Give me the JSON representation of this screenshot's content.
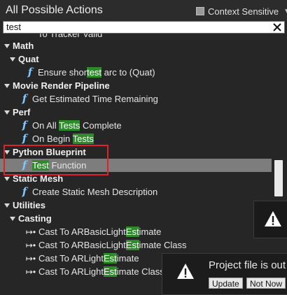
{
  "header": {
    "title": "All Possible Actions",
    "context_sensitive_label": "Context Sensitive",
    "context_sensitive_checked": false
  },
  "search": {
    "value": "test",
    "placeholder": ""
  },
  "list": {
    "partial_top": "To Tracker Valid",
    "rows": [
      {
        "kind": "cat",
        "label": "Math"
      },
      {
        "kind": "cat",
        "label": "Quat"
      },
      {
        "kind": "fn",
        "pre": "Ensure shor",
        "hl": "test",
        "post": " arc to (Quat)"
      },
      {
        "kind": "cat",
        "label": "Movie Render Pipeline"
      },
      {
        "kind": "fn",
        "pre": "Get Estimated Time Remaining",
        "hl": "",
        "post": ""
      },
      {
        "kind": "cat",
        "label": "Perf"
      },
      {
        "kind": "fn",
        "pre": "On All ",
        "hl": "Tests",
        "post": " Complete"
      },
      {
        "kind": "fn",
        "pre": "On Begin ",
        "hl": "Tests",
        "post": ""
      },
      {
        "kind": "cat",
        "label": "Python Blueprint"
      },
      {
        "kind": "fn",
        "pre": "",
        "hl": "Test",
        "post": " Function",
        "selected": true
      },
      {
        "kind": "cat",
        "label": "Static Mesh"
      },
      {
        "kind": "fn",
        "pre": "Create Static Mesh Description",
        "hl": "",
        "post": ""
      },
      {
        "kind": "cat",
        "label": "Utilities"
      },
      {
        "kind": "cat",
        "label": "Casting"
      },
      {
        "kind": "cast",
        "pre": "Cast To ARBasicLight",
        "hl": "Est",
        "post": "imate"
      },
      {
        "kind": "cast",
        "pre": "Cast To ARBasicLight",
        "hl": "Est",
        "post": "imate Class"
      },
      {
        "kind": "cast",
        "pre": "Cast To ARLight",
        "hl": "Est",
        "post": "imate"
      },
      {
        "kind": "cast",
        "pre": "Cast To ARLight",
        "hl": "Est",
        "post": "imate Class"
      }
    ]
  },
  "notification": {
    "text": "Project file is out",
    "update_label": "Update",
    "not_now_label": "Not Now"
  },
  "colors": {
    "highlight": "#2f8a2c",
    "selected_row": "#7d7d7d",
    "function_icon": "#7ec8ff",
    "annotation": "#e0202a"
  },
  "icons": {
    "function": "function-f-icon",
    "cast": "cast-arrow-icon",
    "warning": "warning-triangle-icon",
    "clear": "close-x-icon"
  }
}
